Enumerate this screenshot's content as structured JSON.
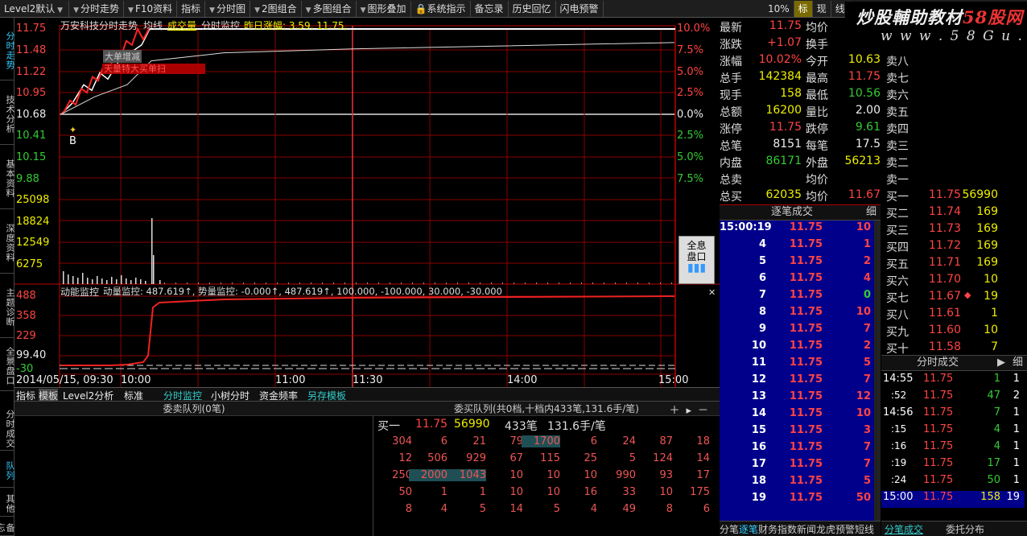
{
  "toolbar": {
    "items": [
      "Level2默认",
      "分时走势",
      "F10资料",
      "指标",
      "分时图",
      "2图组合",
      "多图组合",
      "图形叠加",
      "系统指示",
      "备忘录",
      "历史回忆",
      "闪电预警"
    ],
    "right": [
      "10%",
      "标",
      "现",
      "线"
    ]
  },
  "watermark": {
    "line1_a": "炒股輔助教材",
    "line1_b": "58股网",
    "line2": "w w w . 5 8 G u . c o m"
  },
  "left_tabs": [
    "分时走势",
    "技术分析",
    "基本资料",
    "深度资料",
    "主题诊断",
    "全景盘口"
  ],
  "left_tabs_bottom": [
    "分时成交",
    "队列",
    "其他",
    "备忘"
  ],
  "chart_header": {
    "stock": "万安科技分时走势",
    "avg": "均线",
    "vol": "成交量",
    "mon": "分时监控",
    "prev": "昨日涨幅: 3.59, 11.75,"
  },
  "price_labels": [
    "11.75",
    "11.48",
    "11.22",
    "10.95",
    "10.68",
    "10.41",
    "10.15",
    "9.88"
  ],
  "pct_labels": [
    "10.0%",
    "7.5%",
    "5.0%",
    "2.5%",
    "0.0%",
    "2.5%",
    "5.0%",
    "7.5%"
  ],
  "vol_labels": [
    "25098",
    "18824",
    "12549",
    "6275"
  ],
  "overlay": {
    "big": "大单增减",
    "red_box": "天量特大买单扫",
    "b_marker": "B"
  },
  "indicator": {
    "title": "动能监控",
    "label": "动量监控: 487.619↑, 势量监控: -0.000↑, 487.619↑, 100.000, -100.000, 30.000, -30.000",
    "labels": [
      "488",
      "358",
      "229",
      "99.40",
      "-30"
    ]
  },
  "time_axis": {
    "date": "2014/05/15, 09:30",
    "ticks": [
      "10:00",
      "11:00",
      "11:30",
      "14:00",
      "15:00"
    ]
  },
  "panorama_btn": [
    "全息",
    "盘口"
  ],
  "chart_data": {
    "type": "line",
    "series": [
      {
        "name": "price",
        "x": [
          "09:30",
          "09:35",
          "09:40",
          "09:45",
          "09:50",
          "09:55",
          "10:00",
          "10:05",
          "10:10",
          "10:15",
          "10:30",
          "11:30",
          "13:00",
          "15:00"
        ],
        "y": [
          10.68,
          10.82,
          11.05,
          10.98,
          11.2,
          11.12,
          11.35,
          11.48,
          11.55,
          11.75,
          11.75,
          11.75,
          11.75,
          11.75
        ]
      }
    ],
    "ylim": [
      9.88,
      11.75
    ],
    "xlabel": "",
    "ylabel": ""
  },
  "quote": {
    "rows": [
      [
        "最新",
        "11.75",
        "均价",
        ""
      ],
      [
        "涨跌",
        "+1.07",
        "换手",
        ""
      ],
      [
        "涨幅",
        "10.02%",
        "今开",
        "10.63"
      ],
      [
        "总手",
        "142384",
        "最高",
        "11.75"
      ],
      [
        "现手",
        "158",
        "最低",
        "10.56"
      ],
      [
        "总额",
        "16200",
        "量比",
        "2.00"
      ],
      [
        "涨停",
        "11.75",
        "跌停",
        "9.61"
      ],
      [
        "总笔",
        "8151",
        "每笔",
        "17.5"
      ],
      [
        "内盘",
        "86171",
        "外盘",
        "56213"
      ],
      [
        "总卖",
        "",
        "均价",
        ""
      ],
      [
        "总买",
        "62035",
        "均价",
        "11.67"
      ]
    ],
    "sell": [
      "卖八",
      "卖七",
      "卖六",
      "卖五",
      "卖四",
      "卖三",
      "卖二",
      "卖一"
    ],
    "buy": [
      [
        "买一",
        "11.75",
        "56990"
      ],
      [
        "买二",
        "11.74",
        "169"
      ],
      [
        "买三",
        "11.73",
        "169"
      ],
      [
        "买四",
        "11.72",
        "169"
      ],
      [
        "买五",
        "11.71",
        "169"
      ],
      [
        "买六",
        "11.70",
        "10"
      ],
      [
        "买七",
        "11.67",
        "19"
      ],
      [
        "买八",
        "11.61",
        "1"
      ],
      [
        "买九",
        "11.60",
        "10"
      ],
      [
        "买十",
        "11.58",
        "7"
      ]
    ]
  },
  "trades": {
    "header": "逐笔成交",
    "detail": "细",
    "rows": [
      [
        "15:00:19",
        "11.75",
        "10"
      ],
      [
        "4",
        "11.75",
        "1"
      ],
      [
        "5",
        "11.75",
        "2"
      ],
      [
        "6",
        "11.75",
        "4"
      ],
      [
        "7",
        "11.75",
        "0"
      ],
      [
        "8",
        "11.75",
        "10"
      ],
      [
        "9",
        "11.75",
        "7"
      ],
      [
        "10",
        "11.75",
        "2"
      ],
      [
        "11",
        "11.75",
        "5"
      ],
      [
        "12",
        "11.75",
        "7"
      ],
      [
        "13",
        "11.75",
        "12"
      ],
      [
        "14",
        "11.75",
        "10"
      ],
      [
        "15",
        "11.75",
        "3"
      ],
      [
        "16",
        "11.75",
        "7"
      ],
      [
        "17",
        "11.75",
        "7"
      ],
      [
        "18",
        "11.75",
        "5"
      ],
      [
        "19",
        "11.75",
        "50"
      ]
    ],
    "tabs": [
      "分笔",
      "逐笔",
      "财务",
      "指数",
      "新闻",
      "龙虎",
      "预警",
      "短线"
    ]
  },
  "minute": {
    "header": "分时成交",
    "detail": "细",
    "rows": [
      [
        "14:55",
        "11.75",
        "1",
        "1"
      ],
      [
        ":52",
        "11.75",
        "47",
        "2"
      ],
      [
        "14:56",
        "11.75",
        "7",
        "1"
      ],
      [
        ":15",
        "11.75",
        "4",
        "1"
      ],
      [
        ":16",
        "11.75",
        "4",
        "1"
      ],
      [
        ":19",
        "11.75",
        "17",
        "1"
      ],
      [
        ":24",
        "11.75",
        "50",
        "1"
      ],
      [
        "15:00",
        "11.75",
        "158",
        "19"
      ]
    ],
    "tabs": [
      "分笔成交",
      "委托分布"
    ]
  },
  "bottom_tabs": [
    "指标",
    "模板",
    "Level2分析",
    "标准",
    "分时监控",
    "小树分时",
    "资金频率",
    "另存模板"
  ],
  "sell_queue": {
    "title": "委卖队列(0笔)"
  },
  "buy_queue": {
    "title": "委买队列(共0档,十档内433笔,131.6手/笔)",
    "first": [
      "买一",
      "11.75",
      "56990",
      "433笔",
      "131.6手/笔"
    ],
    "grid": [
      [
        "304",
        "6",
        "21",
        "79",
        "1700",
        "6",
        "24",
        "87",
        "18"
      ],
      [
        "12",
        "506",
        "929",
        "67",
        "115",
        "25",
        "5",
        "124",
        "14"
      ],
      [
        "250",
        "2000",
        "1043",
        "10",
        "10",
        "10",
        "990",
        "93",
        "17"
      ],
      [
        "50",
        "1",
        "1",
        "10",
        "10",
        "16",
        "33",
        "10",
        "175"
      ],
      [
        "8",
        "4",
        "5",
        "14",
        "5",
        "4",
        "49",
        "8",
        "6"
      ]
    ]
  }
}
